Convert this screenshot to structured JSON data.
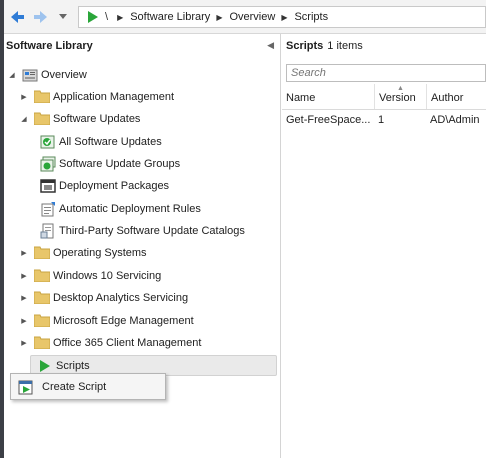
{
  "address_bar": {
    "root_sep": "\\",
    "breadcrumbs": [
      "Software Library",
      "Overview",
      "Scripts"
    ]
  },
  "nav_pane": {
    "title": "Software Library",
    "tree": {
      "overview": "Overview",
      "application_management": "Application Management",
      "software_updates": "Software Updates",
      "all_software_updates": "All Software Updates",
      "software_update_groups": "Software Update Groups",
      "deployment_packages": "Deployment Packages",
      "automatic_deployment_rules": "Automatic Deployment Rules",
      "third_party_catalogs": "Third-Party Software Update Catalogs",
      "operating_systems": "Operating Systems",
      "windows_10_servicing": "Windows 10 Servicing",
      "desktop_analytics_servicing": "Desktop Analytics Servicing",
      "microsoft_edge_management": "Microsoft Edge Management",
      "office_365_client_management": "Office 365 Client Management",
      "scripts": "Scripts"
    }
  },
  "context_menu": {
    "create_script": "Create Script"
  },
  "content": {
    "title": "Scripts",
    "count_text": "1 items",
    "search_placeholder": "Search",
    "columns": {
      "name": "Name",
      "version": "Version",
      "author": "Author"
    },
    "rows": [
      {
        "name": "Get-FreeSpace...",
        "version": "1",
        "author": "AD\\Admin"
      }
    ]
  },
  "icons": {
    "back": "arrow-left-icon",
    "forward": "arrow-right-icon",
    "folder": "folder-icon",
    "scripts": "green-play-icon"
  },
  "colors": {
    "folder": "#e8c66a",
    "selected": "#eaeaea",
    "accent_green": "#2aa63a",
    "nav_blue": "#2f7cd6"
  }
}
